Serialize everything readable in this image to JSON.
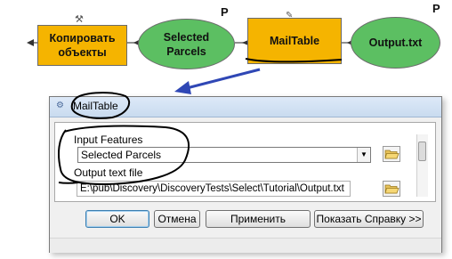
{
  "diagram": {
    "node_copy": {
      "label_line1": "Копировать",
      "label_line2": "объекты"
    },
    "node_selected": {
      "label_line1": "Selected",
      "label_line2": "Parcels"
    },
    "node_mailtable": {
      "label": "MailTable"
    },
    "node_output": {
      "label": "Output.txt"
    },
    "param_mark_1": "P",
    "param_mark_2": "P",
    "colors": {
      "tool_fill": "#f5b400",
      "data_fill": "#5cbf62",
      "annotation": "#000000",
      "pointer_arrow": "#2f47b5"
    }
  },
  "dialog": {
    "title": "MailTable",
    "input_features_label": "Input Features",
    "input_features_value": "Selected Parcels",
    "output_label": "Output text file",
    "output_value": "E:\\pub\\Discovery\\DiscoveryTests\\Select\\Tutorial\\Output.txt",
    "buttons": {
      "ok": "OK",
      "cancel": "Отмена",
      "apply": "Применить",
      "help": "Показать Справку >>"
    }
  }
}
